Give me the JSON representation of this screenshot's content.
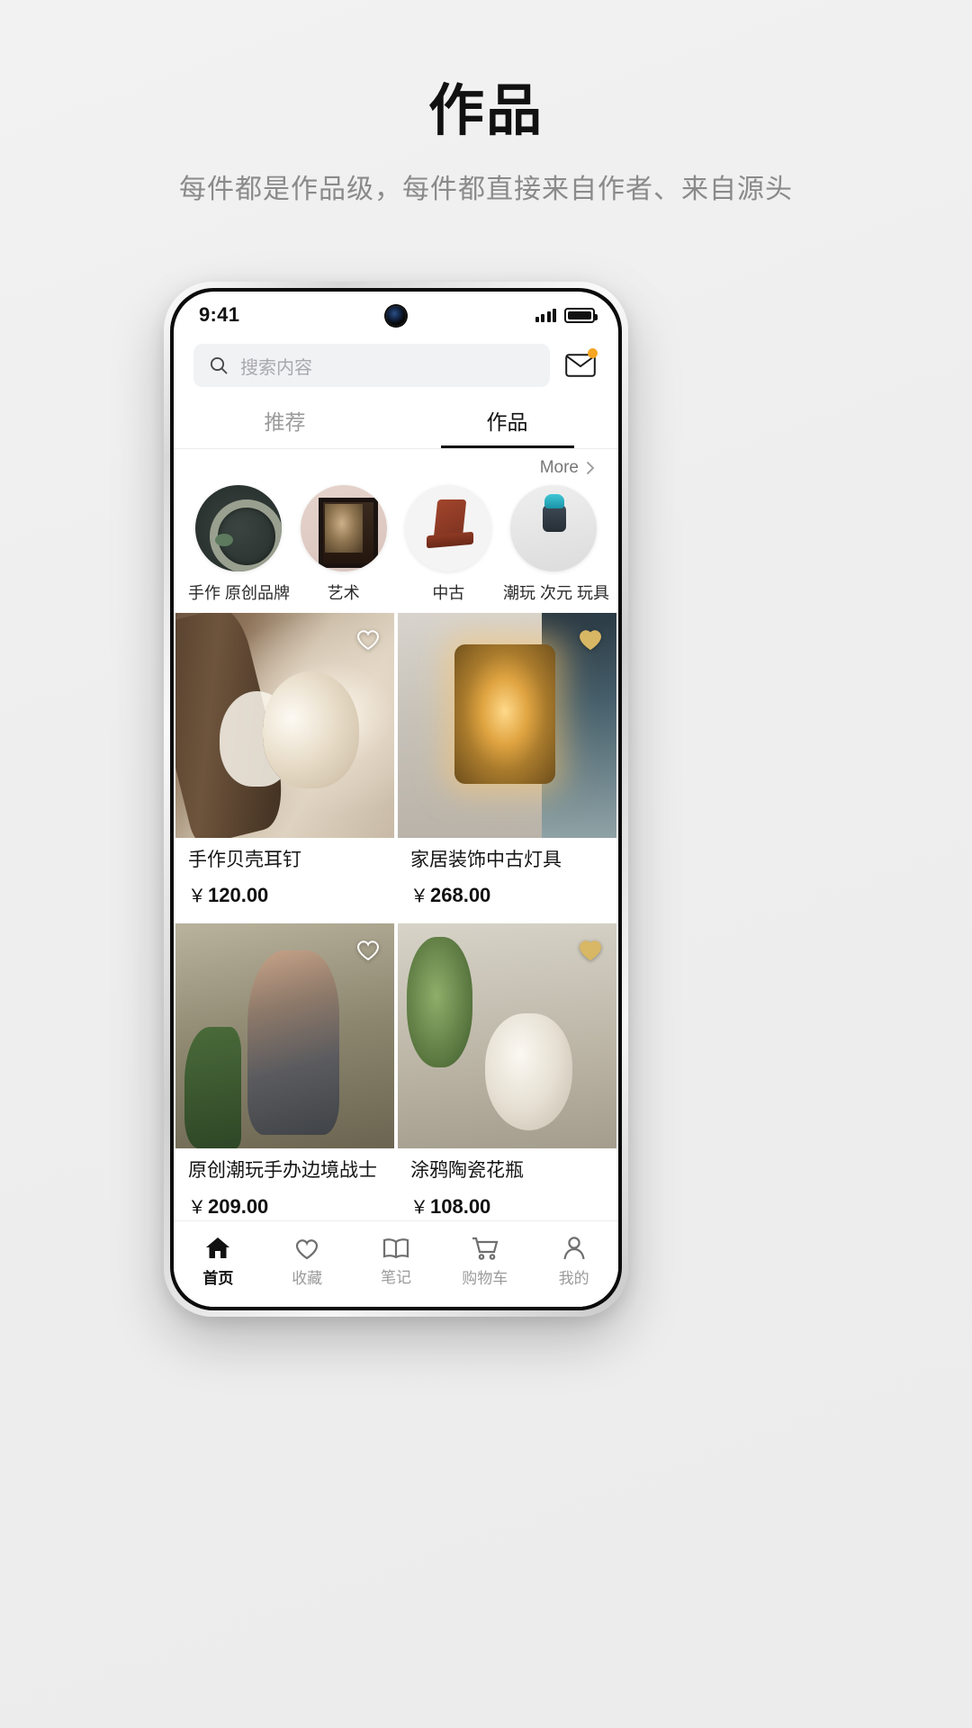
{
  "hero": {
    "title": "作品",
    "subtitle": "每件都是作品级，每件都直接来自作者、来自源头"
  },
  "colors": {
    "accent": "#111111",
    "muted": "#9b9b9b",
    "badge": "#f5a623",
    "heart_active": "#d8b765",
    "search_bg": "#f1f2f4"
  },
  "phone": {
    "status_bar": {
      "time": "9:41",
      "signal_icon": "signal-bars-icon",
      "battery_icon": "battery-full-icon",
      "camera_icon": "front-camera-icon"
    },
    "search": {
      "placeholder": "搜索内容",
      "icon": "search-icon",
      "mail_icon": "mail-icon",
      "mail_has_badge": true
    },
    "tabs": [
      {
        "label": "推荐",
        "active": false
      },
      {
        "label": "作品",
        "active": true
      }
    ],
    "more": {
      "label": "More",
      "icon": "chevron-right-icon"
    },
    "categories": [
      {
        "label": "手作 原创品牌",
        "image": "handmade-jewelry-thumb"
      },
      {
        "label": "艺术",
        "image": "framed-artwork-thumb"
      },
      {
        "label": "中古",
        "image": "vintage-chair-thumb"
      },
      {
        "label": "潮玩 次元 玩具",
        "image": "designer-toy-thumb"
      }
    ],
    "products": [
      {
        "title": "手作贝壳耳钉",
        "currency": "￥",
        "price": "120.00",
        "favorite": false,
        "image": "shell-earrings"
      },
      {
        "title": "家居装饰中古灯具",
        "currency": "￥",
        "price": "268.00",
        "favorite": true,
        "image": "vintage-lantern"
      },
      {
        "title": "原创潮玩手办边境战士",
        "currency": "￥",
        "price": "209.00",
        "favorite": false,
        "image": "border-warrior-figure"
      },
      {
        "title": "涂鸦陶瓷花瓶",
        "currency": "￥",
        "price": "108.00",
        "favorite": true,
        "image": "graffiti-ceramic-vase"
      },
      {
        "title": "",
        "currency": "",
        "price": "",
        "favorite": false,
        "image": "canvas-bag"
      },
      {
        "title": "",
        "currency": "",
        "price": "",
        "favorite": true,
        "image": "navy-hat"
      }
    ],
    "bottom_nav": [
      {
        "label": "首页",
        "icon": "home-icon",
        "active": true
      },
      {
        "label": "收藏",
        "icon": "heart-icon",
        "active": false
      },
      {
        "label": "笔记",
        "icon": "book-icon",
        "active": false
      },
      {
        "label": "购物车",
        "icon": "cart-icon",
        "active": false
      },
      {
        "label": "我的",
        "icon": "user-icon",
        "active": false
      }
    ]
  }
}
